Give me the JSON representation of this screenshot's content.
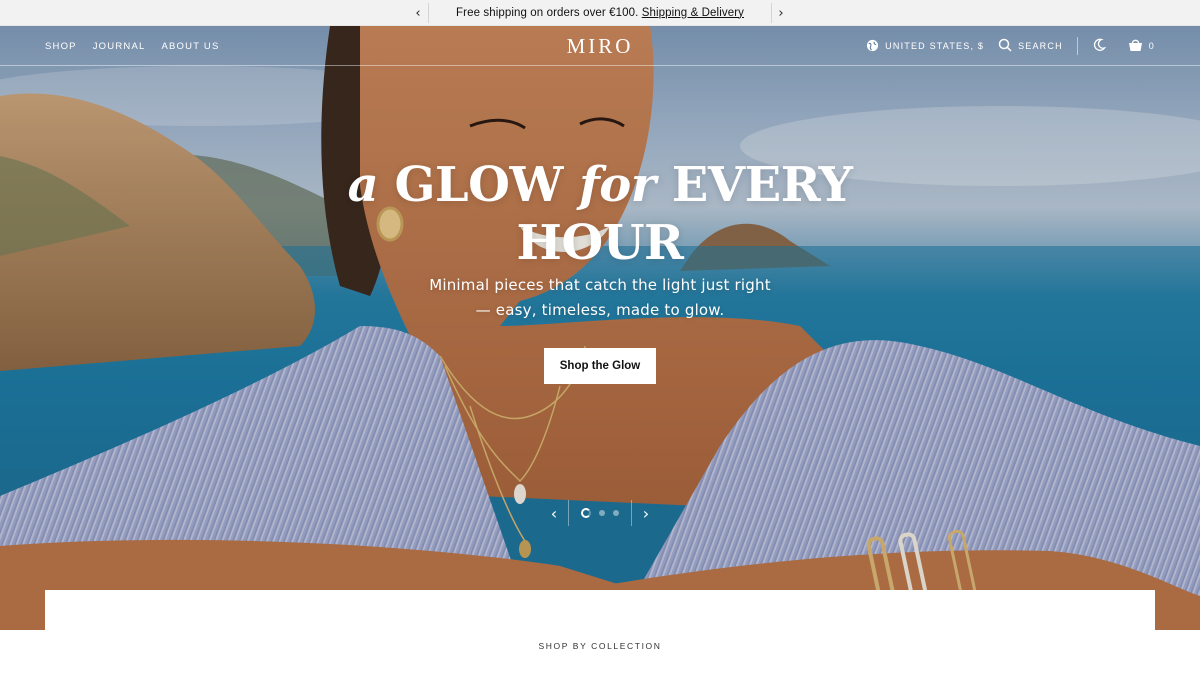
{
  "announcement": {
    "message": "Free shipping on orders over €100.",
    "link_label": "Shipping & Delivery",
    "prev_icon": "chevron-left-icon",
    "next_icon": "chevron-right-icon"
  },
  "header": {
    "nav": [
      {
        "label": "SHOP"
      },
      {
        "label": "JOURNAL"
      },
      {
        "label": "ABOUT US"
      }
    ],
    "logo": "MIRO",
    "locale_label": "UNITED STATES, $",
    "search_label": "SEARCH",
    "cart_count": "0",
    "icons": [
      "globe-icon",
      "search-icon",
      "moon-icon",
      "cart-icon"
    ]
  },
  "hero": {
    "headline_italic_1": "a",
    "headline_part_1": "GLOW",
    "headline_italic_2": "for",
    "headline_part_2": "EVERY HOUR",
    "subheading": "Minimal pieces that catch the light just right — easy, timeless, made to glow.",
    "cta_label": "Shop the Glow",
    "slides_total": 3,
    "active_slide": 1
  },
  "section": {
    "label": "SHOP BY COLLECTION"
  },
  "colors": {
    "announcement_bg": "#f2f2f2",
    "text_on_hero": "#ffffff",
    "cta_bg": "#ffffff",
    "sea": "#1f7aa3",
    "shirt": "#8c97c3"
  }
}
